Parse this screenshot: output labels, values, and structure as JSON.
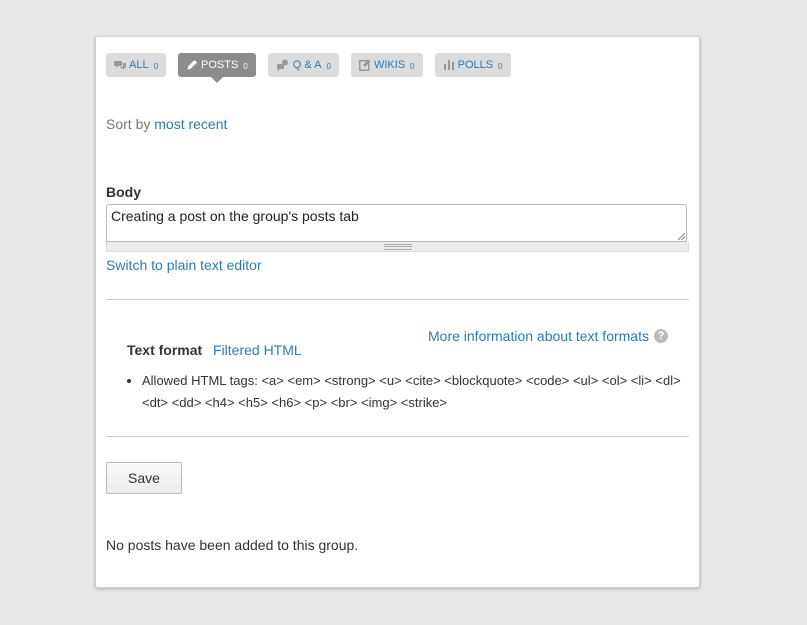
{
  "tabs": [
    {
      "label": "ALL",
      "count": "0",
      "icon": "chat-bubbles-icon",
      "active": false
    },
    {
      "label": "POSTS",
      "count": "0",
      "icon": "pencil-icon",
      "active": true
    },
    {
      "label": "Q & A",
      "count": "0",
      "icon": "question-answer-icon",
      "active": false
    },
    {
      "label": "WIKIS",
      "count": "0",
      "icon": "edit-document-icon",
      "active": false
    },
    {
      "label": "POLLS",
      "count": "0",
      "icon": "bar-chart-icon",
      "active": false
    }
  ],
  "sort": {
    "prefix": "Sort by",
    "value": "most recent"
  },
  "body": {
    "label": "Body",
    "value": "Creating a post on the group's posts tab"
  },
  "switch_link": "Switch to plain text editor",
  "text_format": {
    "label": "Text format",
    "value": "Filtered HTML",
    "more_info": "More information about text formats",
    "help_icon": "?",
    "tips": [
      "Allowed HTML tags: <a> <em> <strong> <u> <cite> <blockquote> <code> <ul> <ol> <li> <dl> <dt> <dd> <h4> <h5> <h6> <p> <br> <img> <strike>"
    ]
  },
  "save_label": "Save",
  "empty_message": "No posts have been added to this group.",
  "colors": {
    "link": "#2b7bb9",
    "active_tab": "#8c8c8c",
    "tab_bg": "#dcdcdc"
  }
}
